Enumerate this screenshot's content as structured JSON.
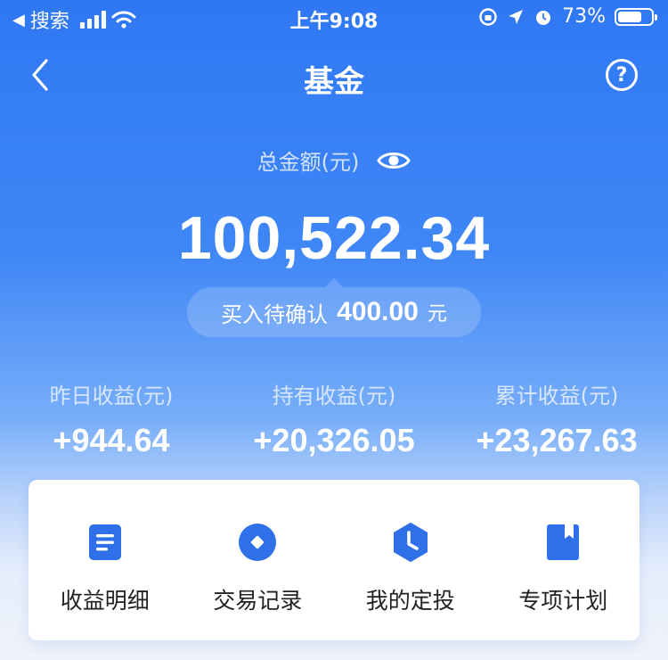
{
  "status_bar": {
    "back_app": "搜索",
    "time": "上午9:08",
    "battery": "73%",
    "battery_level": 0.73
  },
  "nav": {
    "title": "基金",
    "help_icon": "question-circle-icon",
    "back_icon": "chevron-left-icon"
  },
  "summary": {
    "total_label": "总金额(元)",
    "total_amount": "100,522.34",
    "pending_label": "买入待确认",
    "pending_amount": "400.00",
    "pending_unit": "元"
  },
  "stats": [
    {
      "label": "昨日收益(元)",
      "value": "+944.64"
    },
    {
      "label": "持有收益(元)",
      "value": "+20,326.05"
    },
    {
      "label": "累计收益(元)",
      "value": "+23,267.63"
    }
  ],
  "menu": [
    {
      "label": "收益明细",
      "icon": "document-icon"
    },
    {
      "label": "交易记录",
      "icon": "record-circle-icon"
    },
    {
      "label": "我的定投",
      "icon": "clock-hexagon-icon"
    },
    {
      "label": "专项计划",
      "icon": "bookmark-book-icon"
    }
  ],
  "colors": {
    "primary": "#2f78f3",
    "icon_blue": "#2f6fe8",
    "text_dark": "#222222"
  }
}
